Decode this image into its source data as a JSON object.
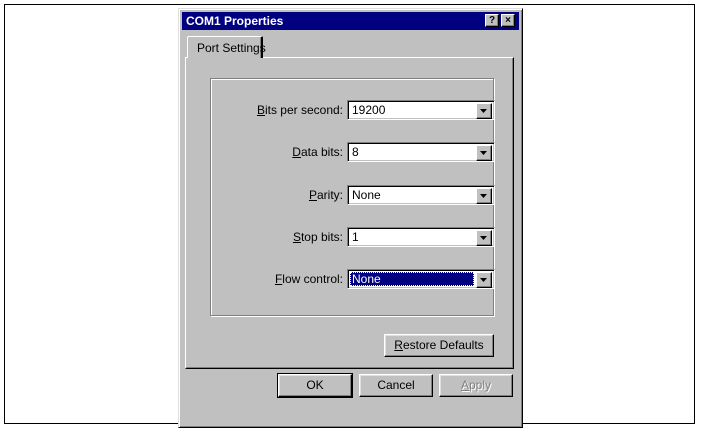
{
  "dialog": {
    "title": "COM1 Properties",
    "help_glyph": "?",
    "close_glyph": "×"
  },
  "tabs": [
    {
      "label": "Port Settings",
      "active": true
    }
  ],
  "fields": {
    "bits_per_second": {
      "mnemonic": "B",
      "label_rest": "its per second:",
      "value": "19200"
    },
    "data_bits": {
      "mnemonic": "D",
      "label_rest": "ata bits:",
      "value": "8"
    },
    "parity": {
      "mnemonic": "P",
      "label_rest": "arity:",
      "value": "None"
    },
    "stop_bits": {
      "mnemonic": "S",
      "label_rest": "top bits:",
      "value": "1"
    },
    "flow_control": {
      "mnemonic": "F",
      "label_rest": "low control:",
      "value": "None",
      "focused": true
    }
  },
  "buttons": {
    "restore_mnemonic": "R",
    "restore_rest": "estore Defaults",
    "ok": "OK",
    "cancel": "Cancel",
    "apply_mnemonic": "A",
    "apply_rest": "pply"
  },
  "colors": {
    "face": "#c0c0c0",
    "titlebar": "#000080",
    "selection": "#000080"
  },
  "icons": {
    "combo_arrow": "triangle-down-icon"
  }
}
